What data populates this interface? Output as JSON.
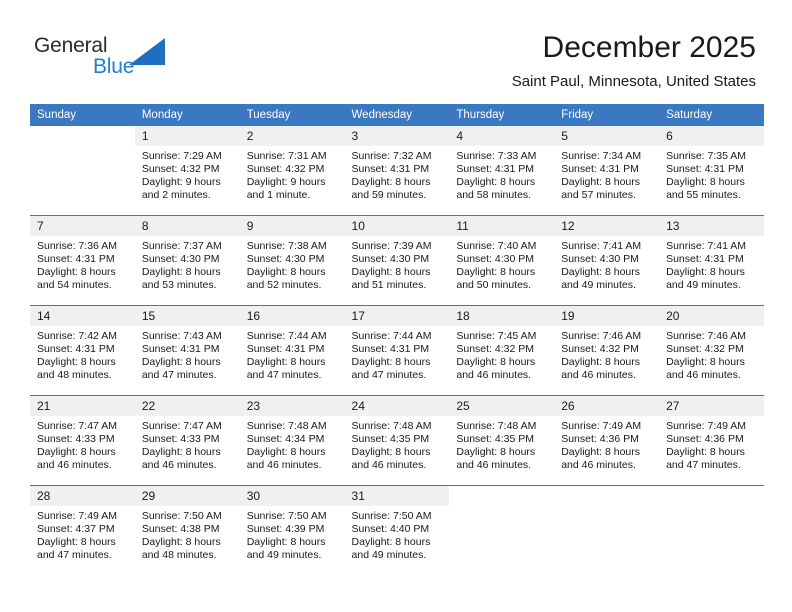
{
  "brand": {
    "name_part1": "General",
    "name_part2": "Blue",
    "logo_icon": "triangle-flag-icon",
    "accent_color": "#1f7fd0"
  },
  "header": {
    "title": "December 2025",
    "subtitle": "Saint Paul, Minnesota, United States"
  },
  "theme": {
    "header_bg": "#3b78c2",
    "daynum_bg": "#f0f0f0",
    "grid_line": "#3b78c2",
    "text": "#1a1a1a"
  },
  "weekday_headers": [
    "Sunday",
    "Monday",
    "Tuesday",
    "Wednesday",
    "Thursday",
    "Friday",
    "Saturday"
  ],
  "weeks": [
    [
      {
        "day": "",
        "empty": true,
        "sunrise": "",
        "sunset": "",
        "daylight_line1": "",
        "daylight_line2": ""
      },
      {
        "day": "1",
        "sunrise": "Sunrise: 7:29 AM",
        "sunset": "Sunset: 4:32 PM",
        "daylight_line1": "Daylight: 9 hours",
        "daylight_line2": "and 2 minutes."
      },
      {
        "day": "2",
        "sunrise": "Sunrise: 7:31 AM",
        "sunset": "Sunset: 4:32 PM",
        "daylight_line1": "Daylight: 9 hours",
        "daylight_line2": "and 1 minute."
      },
      {
        "day": "3",
        "sunrise": "Sunrise: 7:32 AM",
        "sunset": "Sunset: 4:31 PM",
        "daylight_line1": "Daylight: 8 hours",
        "daylight_line2": "and 59 minutes."
      },
      {
        "day": "4",
        "sunrise": "Sunrise: 7:33 AM",
        "sunset": "Sunset: 4:31 PM",
        "daylight_line1": "Daylight: 8 hours",
        "daylight_line2": "and 58 minutes."
      },
      {
        "day": "5",
        "sunrise": "Sunrise: 7:34 AM",
        "sunset": "Sunset: 4:31 PM",
        "daylight_line1": "Daylight: 8 hours",
        "daylight_line2": "and 57 minutes."
      },
      {
        "day": "6",
        "sunrise": "Sunrise: 7:35 AM",
        "sunset": "Sunset: 4:31 PM",
        "daylight_line1": "Daylight: 8 hours",
        "daylight_line2": "and 55 minutes."
      }
    ],
    [
      {
        "day": "7",
        "sunrise": "Sunrise: 7:36 AM",
        "sunset": "Sunset: 4:31 PM",
        "daylight_line1": "Daylight: 8 hours",
        "daylight_line2": "and 54 minutes."
      },
      {
        "day": "8",
        "sunrise": "Sunrise: 7:37 AM",
        "sunset": "Sunset: 4:30 PM",
        "daylight_line1": "Daylight: 8 hours",
        "daylight_line2": "and 53 minutes."
      },
      {
        "day": "9",
        "sunrise": "Sunrise: 7:38 AM",
        "sunset": "Sunset: 4:30 PM",
        "daylight_line1": "Daylight: 8 hours",
        "daylight_line2": "and 52 minutes."
      },
      {
        "day": "10",
        "sunrise": "Sunrise: 7:39 AM",
        "sunset": "Sunset: 4:30 PM",
        "daylight_line1": "Daylight: 8 hours",
        "daylight_line2": "and 51 minutes."
      },
      {
        "day": "11",
        "sunrise": "Sunrise: 7:40 AM",
        "sunset": "Sunset: 4:30 PM",
        "daylight_line1": "Daylight: 8 hours",
        "daylight_line2": "and 50 minutes."
      },
      {
        "day": "12",
        "sunrise": "Sunrise: 7:41 AM",
        "sunset": "Sunset: 4:30 PM",
        "daylight_line1": "Daylight: 8 hours",
        "daylight_line2": "and 49 minutes."
      },
      {
        "day": "13",
        "sunrise": "Sunrise: 7:41 AM",
        "sunset": "Sunset: 4:31 PM",
        "daylight_line1": "Daylight: 8 hours",
        "daylight_line2": "and 49 minutes."
      }
    ],
    [
      {
        "day": "14",
        "sunrise": "Sunrise: 7:42 AM",
        "sunset": "Sunset: 4:31 PM",
        "daylight_line1": "Daylight: 8 hours",
        "daylight_line2": "and 48 minutes."
      },
      {
        "day": "15",
        "sunrise": "Sunrise: 7:43 AM",
        "sunset": "Sunset: 4:31 PM",
        "daylight_line1": "Daylight: 8 hours",
        "daylight_line2": "and 47 minutes."
      },
      {
        "day": "16",
        "sunrise": "Sunrise: 7:44 AM",
        "sunset": "Sunset: 4:31 PM",
        "daylight_line1": "Daylight: 8 hours",
        "daylight_line2": "and 47 minutes."
      },
      {
        "day": "17",
        "sunrise": "Sunrise: 7:44 AM",
        "sunset": "Sunset: 4:31 PM",
        "daylight_line1": "Daylight: 8 hours",
        "daylight_line2": "and 47 minutes."
      },
      {
        "day": "18",
        "sunrise": "Sunrise: 7:45 AM",
        "sunset": "Sunset: 4:32 PM",
        "daylight_line1": "Daylight: 8 hours",
        "daylight_line2": "and 46 minutes."
      },
      {
        "day": "19",
        "sunrise": "Sunrise: 7:46 AM",
        "sunset": "Sunset: 4:32 PM",
        "daylight_line1": "Daylight: 8 hours",
        "daylight_line2": "and 46 minutes."
      },
      {
        "day": "20",
        "sunrise": "Sunrise: 7:46 AM",
        "sunset": "Sunset: 4:32 PM",
        "daylight_line1": "Daylight: 8 hours",
        "daylight_line2": "and 46 minutes."
      }
    ],
    [
      {
        "day": "21",
        "sunrise": "Sunrise: 7:47 AM",
        "sunset": "Sunset: 4:33 PM",
        "daylight_line1": "Daylight: 8 hours",
        "daylight_line2": "and 46 minutes."
      },
      {
        "day": "22",
        "sunrise": "Sunrise: 7:47 AM",
        "sunset": "Sunset: 4:33 PM",
        "daylight_line1": "Daylight: 8 hours",
        "daylight_line2": "and 46 minutes."
      },
      {
        "day": "23",
        "sunrise": "Sunrise: 7:48 AM",
        "sunset": "Sunset: 4:34 PM",
        "daylight_line1": "Daylight: 8 hours",
        "daylight_line2": "and 46 minutes."
      },
      {
        "day": "24",
        "sunrise": "Sunrise: 7:48 AM",
        "sunset": "Sunset: 4:35 PM",
        "daylight_line1": "Daylight: 8 hours",
        "daylight_line2": "and 46 minutes."
      },
      {
        "day": "25",
        "sunrise": "Sunrise: 7:48 AM",
        "sunset": "Sunset: 4:35 PM",
        "daylight_line1": "Daylight: 8 hours",
        "daylight_line2": "and 46 minutes."
      },
      {
        "day": "26",
        "sunrise": "Sunrise: 7:49 AM",
        "sunset": "Sunset: 4:36 PM",
        "daylight_line1": "Daylight: 8 hours",
        "daylight_line2": "and 46 minutes."
      },
      {
        "day": "27",
        "sunrise": "Sunrise: 7:49 AM",
        "sunset": "Sunset: 4:36 PM",
        "daylight_line1": "Daylight: 8 hours",
        "daylight_line2": "and 47 minutes."
      }
    ],
    [
      {
        "day": "28",
        "sunrise": "Sunrise: 7:49 AM",
        "sunset": "Sunset: 4:37 PM",
        "daylight_line1": "Daylight: 8 hours",
        "daylight_line2": "and 47 minutes."
      },
      {
        "day": "29",
        "sunrise": "Sunrise: 7:50 AM",
        "sunset": "Sunset: 4:38 PM",
        "daylight_line1": "Daylight: 8 hours",
        "daylight_line2": "and 48 minutes."
      },
      {
        "day": "30",
        "sunrise": "Sunrise: 7:50 AM",
        "sunset": "Sunset: 4:39 PM",
        "daylight_line1": "Daylight: 8 hours",
        "daylight_line2": "and 49 minutes."
      },
      {
        "day": "31",
        "sunrise": "Sunrise: 7:50 AM",
        "sunset": "Sunset: 4:40 PM",
        "daylight_line1": "Daylight: 8 hours",
        "daylight_line2": "and 49 minutes."
      },
      {
        "day": "",
        "empty": true,
        "sunrise": "",
        "sunset": "",
        "daylight_line1": "",
        "daylight_line2": ""
      },
      {
        "day": "",
        "empty": true,
        "sunrise": "",
        "sunset": "",
        "daylight_line1": "",
        "daylight_line2": ""
      },
      {
        "day": "",
        "empty": true,
        "sunrise": "",
        "sunset": "",
        "daylight_line1": "",
        "daylight_line2": ""
      }
    ]
  ]
}
